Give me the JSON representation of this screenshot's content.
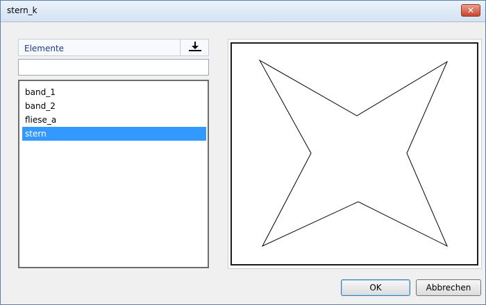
{
  "window": {
    "title": "stern_k"
  },
  "close_glyph": "✕",
  "panel": {
    "header_label": "Elemente",
    "download_icon": "download-icon",
    "filter_value": "",
    "items": [
      {
        "label": "band_1",
        "selected": false
      },
      {
        "label": "band_2",
        "selected": false
      },
      {
        "label": "fliese_a",
        "selected": false
      },
      {
        "label": "stern",
        "selected": true
      }
    ]
  },
  "buttons": {
    "ok": "OK",
    "cancel": "Abbrechen"
  },
  "colors": {
    "selection": "#3399ff",
    "title_text": "#1a3d8c",
    "close": "#c8442b"
  }
}
